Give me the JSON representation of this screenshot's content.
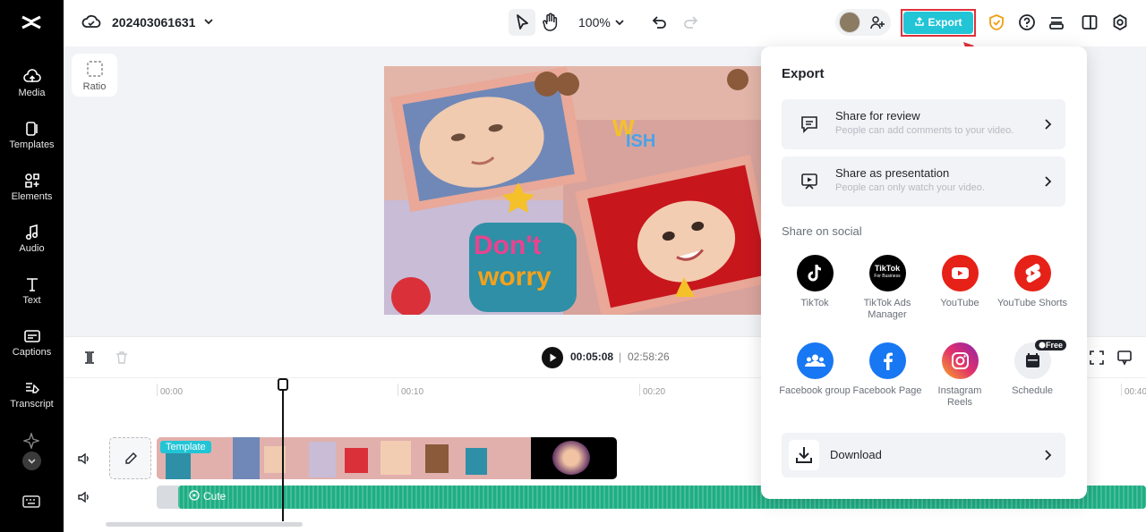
{
  "sidebar": {
    "items": [
      {
        "label": "Media",
        "icon": "cloud-upload-icon"
      },
      {
        "label": "Templates",
        "icon": "templates-icon"
      },
      {
        "label": "Elements",
        "icon": "elements-icon"
      },
      {
        "label": "Audio",
        "icon": "music-note-icon"
      },
      {
        "label": "Text",
        "icon": "text-icon"
      },
      {
        "label": "Captions",
        "icon": "captions-icon"
      },
      {
        "label": "Transcript",
        "icon": "transcript-icon"
      }
    ]
  },
  "header": {
    "project_title": "202403061631",
    "zoom": "100%",
    "export_label": "Export"
  },
  "canvas": {
    "ratio_label": "Ratio"
  },
  "timeline": {
    "current_time": "00:05:08",
    "separator": "|",
    "total_time": "02:58:26",
    "ruler": [
      "00:00",
      "00:10",
      "00:20",
      "00:40"
    ],
    "video_clip_tag": "Template",
    "audio_clip_label": "Cute"
  },
  "export_panel": {
    "title": "Export",
    "share_review": {
      "title": "Share for review",
      "subtitle": "People can add comments to your video."
    },
    "share_presentation": {
      "title": "Share as presentation",
      "subtitle": "People can only watch your video."
    },
    "social_heading": "Share on social",
    "social": [
      {
        "label": "TikTok",
        "color": "#000000",
        "icon": "tiktok-icon"
      },
      {
        "label": "TikTok Ads Manager",
        "color": "#000000",
        "icon": "tiktok-business-icon",
        "logo_text": "TikTok",
        "logo_sub": "For Business"
      },
      {
        "label": "YouTube",
        "color": "#e62117",
        "icon": "youtube-icon"
      },
      {
        "label": "YouTube Shorts",
        "color": "#e62117",
        "icon": "youtube-shorts-icon"
      },
      {
        "label": "Facebook group",
        "color": "#1877f2",
        "icon": "facebook-group-icon"
      },
      {
        "label": "Facebook Page",
        "color": "#1877f2",
        "icon": "facebook-icon"
      },
      {
        "label": "Instagram Reels",
        "color": "#d6249f",
        "icon": "instagram-icon"
      },
      {
        "label": "Schedule",
        "color": "#eceef1",
        "icon": "calendar-icon"
      }
    ],
    "free_badge": "Free",
    "download_label": "Download"
  },
  "colors": {
    "accent": "#22c5d6",
    "annotation": "#e0313b",
    "audio_track": "#1fae84"
  }
}
